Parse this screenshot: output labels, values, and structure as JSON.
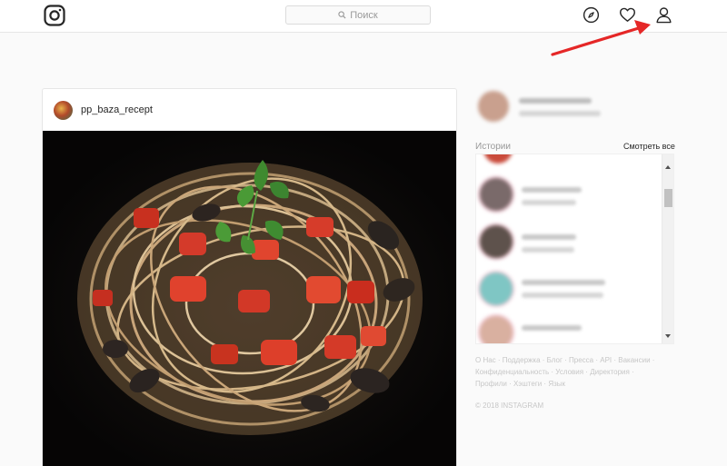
{
  "header": {
    "logo_icon": "instagram-logo-icon",
    "search_placeholder": "Поиск",
    "icons": [
      "compass-icon",
      "heart-icon",
      "profile-icon"
    ]
  },
  "post": {
    "username": "pp_baza_recept",
    "image": "spaghetti-with-mussels-and-tomatoes"
  },
  "sidebar": {
    "stories_label": "Истории",
    "see_all": "Смотреть все",
    "footer_links": [
      "О Нас",
      "Поддержка",
      "Блог",
      "Пресса",
      "API",
      "Вакансии",
      "Конфиденциальность",
      "Условия",
      "Директория",
      "Профили",
      "Хэштеги",
      "Язык"
    ],
    "copyright": "© 2018 INSTAGRAM"
  },
  "annotation": {
    "color": "#e52727"
  }
}
